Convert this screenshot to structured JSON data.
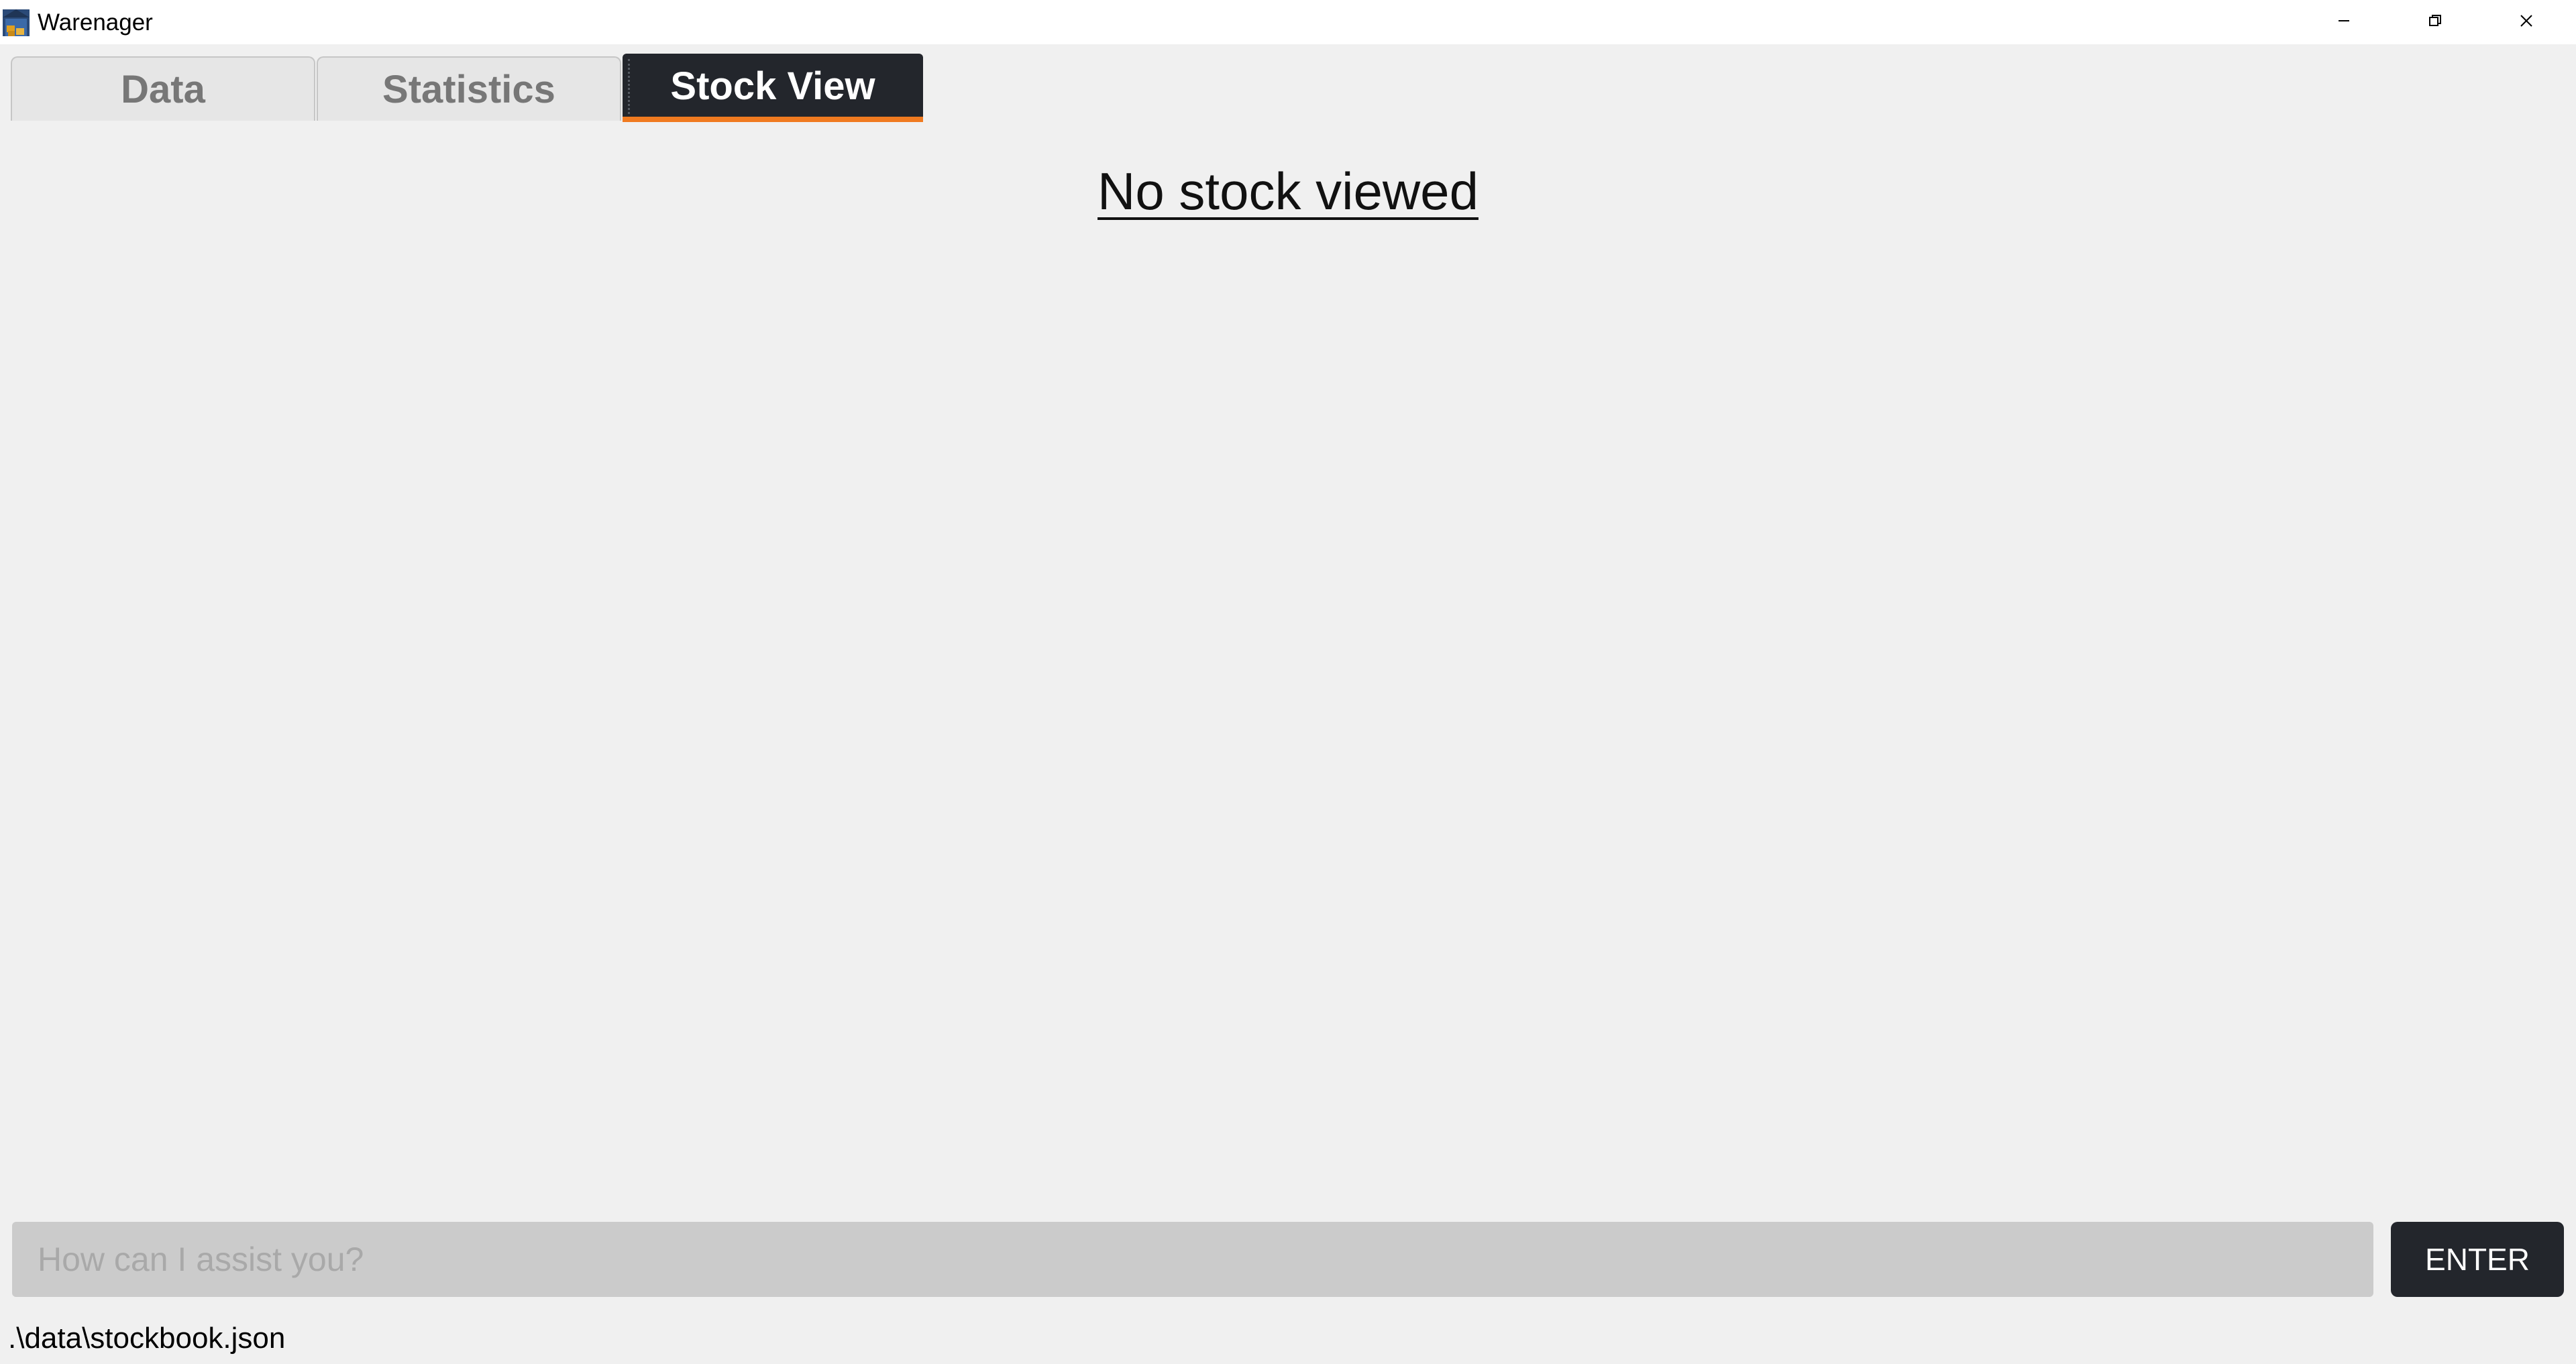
{
  "window": {
    "title": "Warenager",
    "icon": "warehouse-icon",
    "controls": {
      "minimize": "minimize-icon",
      "restore": "restore-icon",
      "close": "close-icon"
    }
  },
  "tabs": [
    {
      "label": "Data",
      "active": false
    },
    {
      "label": "Statistics",
      "active": false
    },
    {
      "label": "Stock View",
      "active": true
    }
  ],
  "main": {
    "message": "No stock viewed"
  },
  "command": {
    "placeholder": "How can I assist you?",
    "value": "",
    "enter_label": "ENTER"
  },
  "status": {
    "file_path": ".\\data\\stockbook.json"
  },
  "colors": {
    "active_tab_bg": "#23262c",
    "active_tab_accent": "#f07a20",
    "background": "#f0f0f0"
  }
}
